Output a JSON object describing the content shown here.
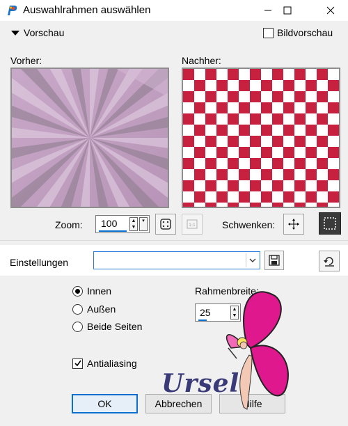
{
  "window": {
    "title": "Auswahlrahmen auswählen",
    "controls": {
      "minimize": "—",
      "maximize": "☐",
      "close": "✕"
    }
  },
  "preview": {
    "toggle_label": "Vorschau",
    "bildvorschau_label": "Bildvorschau",
    "bildvorschau_checked": false,
    "before_label": "Vorher:",
    "after_label": "Nachher:",
    "checker_colors": [
      "#c8203f",
      "#ffffff"
    ]
  },
  "zoom": {
    "label": "Zoom:",
    "value": "100",
    "pan_label": "Schwenken:"
  },
  "settings": {
    "label": "Einstellungen",
    "value": ""
  },
  "options": {
    "radios": [
      {
        "label": "Innen",
        "selected": true
      },
      {
        "label": "Außen",
        "selected": false
      },
      {
        "label": "Beide Seiten",
        "selected": false
      }
    ],
    "antialiasing_label": "Antialiasing",
    "antialiasing_checked": true,
    "width_label": "Rahmenbreite:",
    "width_value": "25"
  },
  "buttons": {
    "ok": "OK",
    "cancel": "Abbrechen",
    "help": "Hilfe"
  },
  "watermark": {
    "signature": "Ursel",
    "signature_color": "#3a3a78"
  },
  "colors": {
    "accent": "#0a6fd1",
    "checker_red": "#c8203f",
    "fairy_pink": "#e0188e"
  }
}
